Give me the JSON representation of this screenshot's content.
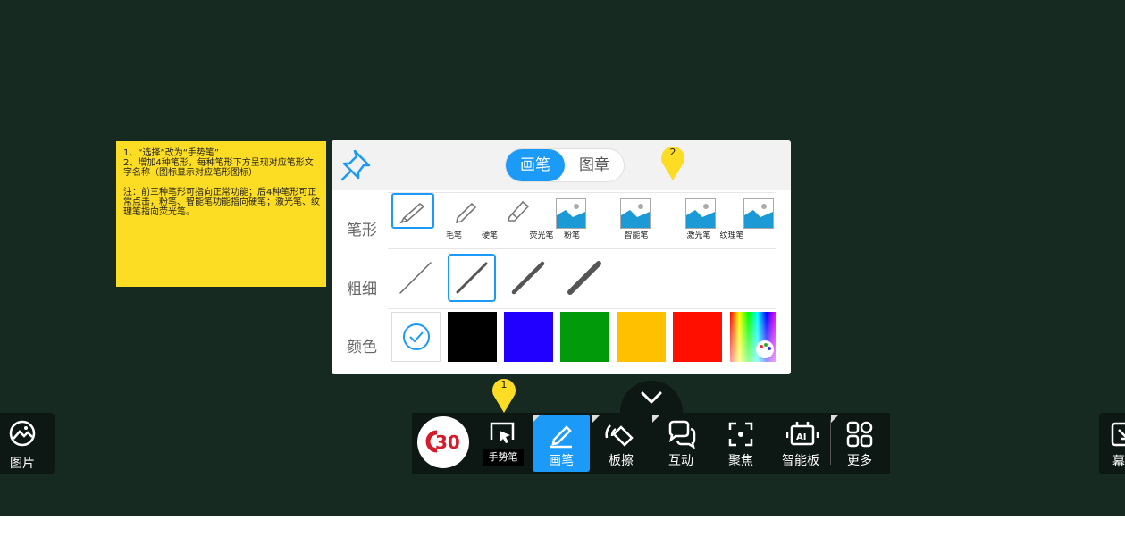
{
  "note": {
    "text": "1、“选择”改为“手势笔”\n2、增加4种笔形，每种笔形下方呈现对应笔形文字名称（图标显示对应笔形图标）\n\n注：前三种笔形可指向正常功能；后4种笔形可正常点击，粉笔、智能笔功能指向硬笔；激光笔、纹理笔指向荧光笔。"
  },
  "panel": {
    "tabs": [
      {
        "label": "画笔",
        "active": true
      },
      {
        "label": "图章",
        "active": false
      }
    ],
    "rows": {
      "pen_shape": "笔形",
      "thickness": "粗细",
      "color": "颜色"
    },
    "pens": [
      {
        "name": "毛笔",
        "selected": true
      },
      {
        "name": "硬笔",
        "selected": false
      },
      {
        "name": "荧光笔",
        "selected": false
      },
      {
        "name": "粉笔",
        "selected": false
      },
      {
        "name": "智能笔",
        "selected": false
      },
      {
        "name": "激光笔",
        "selected": false
      },
      {
        "name": "纹理笔",
        "selected": false
      }
    ],
    "thickness_selected_index": 1,
    "colors": [
      "#ffffff",
      "#000000",
      "#2200ff",
      "#009a0a",
      "#ffc000",
      "#ff0f00",
      "rainbow"
    ],
    "accent": "#1b9af7"
  },
  "markers": [
    "2",
    "1"
  ],
  "toolbar": {
    "gesture_label": "手势笔",
    "pen_label": "画笔",
    "eraser_label": "板擦",
    "interact_label": "互动",
    "focus_label": "聚焦",
    "smartboard_label": "智能板",
    "more_label": "更多",
    "logo_text": "30"
  },
  "side": {
    "left_label": "图片",
    "right_label": "幕"
  }
}
